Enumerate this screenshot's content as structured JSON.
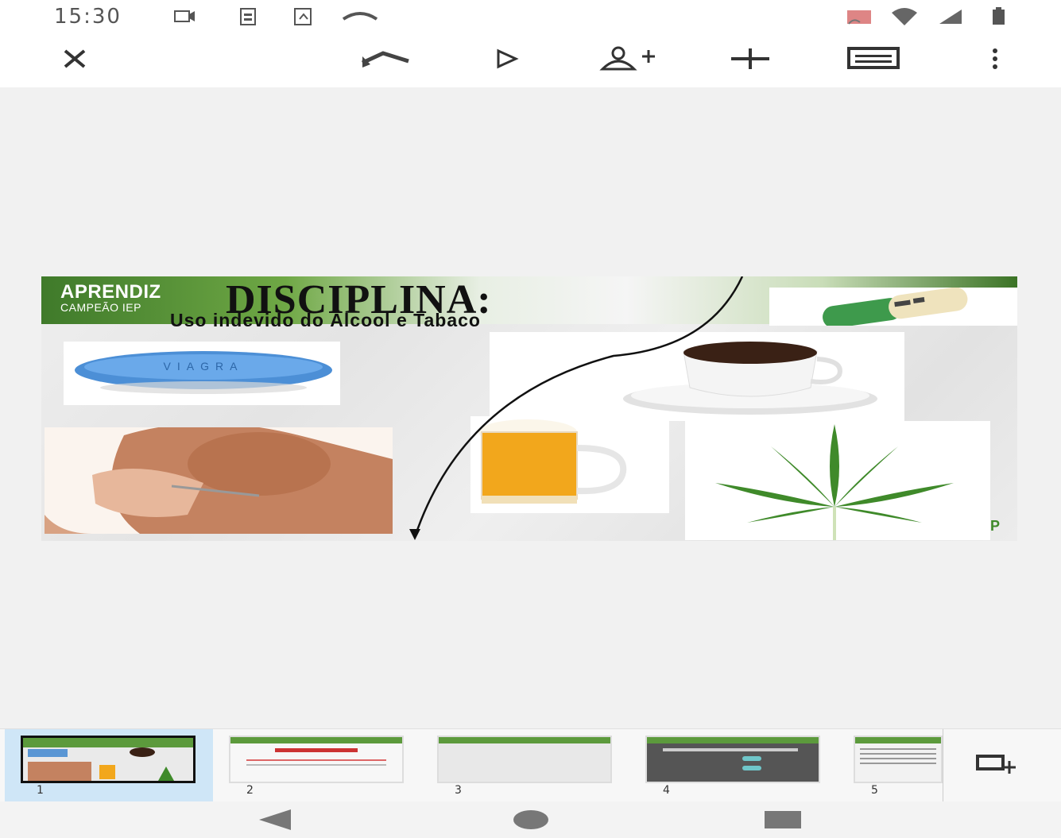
{
  "status_bar": {
    "time": "15:30",
    "icons": [
      "video-icon",
      "contact-card-icon",
      "screenshot-icon",
      "phone-icon",
      "cast-icon",
      "wifi-icon",
      "signal-icon",
      "battery-icon"
    ]
  },
  "toolbar": {
    "buttons": [
      "close-icon",
      "undo-icon",
      "present-icon",
      "add-person-icon",
      "insert-icon",
      "comment-icon",
      "more-options-icon"
    ]
  },
  "slide": {
    "brand_name": "APRENDIZ",
    "brand_sub": "CAMPEÃO IEP",
    "title": "DISCIPLINA:",
    "subtitle": "Uso indevido do Álcool e Tabaco",
    "pill_text": "VIAGRA",
    "corner_mark": "P",
    "accent_green": "#4a8a2e"
  },
  "filmstrip": {
    "slides": [
      {
        "number": "1",
        "selected": true
      },
      {
        "number": "2",
        "selected": false
      },
      {
        "number": "3",
        "selected": false
      },
      {
        "number": "4",
        "selected": false
      },
      {
        "number": "5",
        "selected": false
      }
    ]
  },
  "navbar": {
    "buttons": [
      "back-icon",
      "home-icon",
      "recents-icon"
    ]
  }
}
